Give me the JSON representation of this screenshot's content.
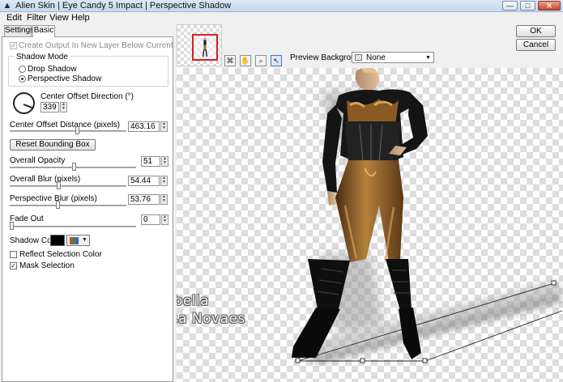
{
  "window": {
    "title": "Alien Skin | Eye Candy 5 Impact | Perspective Shadow",
    "icon": "alien-skin-icon",
    "controls": {
      "minimize": "—",
      "maximize": "□",
      "close": "✕"
    }
  },
  "menu": [
    "Edit",
    "Filter",
    "View",
    "Help"
  ],
  "tabs": [
    {
      "label": "Settings",
      "active": false
    },
    {
      "label": "Basic",
      "active": true
    }
  ],
  "basic": {
    "create_output": {
      "label": "Create Output In New Layer Below Current",
      "checked": true,
      "enabled": false
    },
    "shadow_mode": {
      "title": "Shadow Mode",
      "options": [
        {
          "label": "Drop Shadow",
          "selected": false
        },
        {
          "label": "Perspective Shadow",
          "selected": true
        }
      ]
    },
    "center_offset_direction": {
      "label": "Center Offset Direction (°)",
      "value": "339"
    },
    "center_offset_distance": {
      "label": "Center Offset Distance (pixels)",
      "value": "463.16",
      "level": 0.58
    },
    "reset_button": "Reset Bounding Box",
    "overall_opacity": {
      "label": "Overall Opacity",
      "value": "51",
      "level": 0.51
    },
    "overall_blur": {
      "label": "Overall Blur (pixels)",
      "value": "54.44",
      "level": 0.42
    },
    "perspective_blur": {
      "label": "Perspective Blur (pixels)",
      "value": "53.76",
      "level": 0.41
    },
    "fade_out": {
      "label": "Fade Out",
      "value": "0",
      "level": 0
    },
    "shadow_color": {
      "label": "Shadow Color",
      "value": "#000000"
    },
    "reflect_selection_color": {
      "label": "Reflect Selection Color",
      "checked": false
    },
    "mask_selection": {
      "label": "Mask Selection",
      "checked": true
    }
  },
  "toolbar": {
    "tools": [
      "bounding-box-tool-icon",
      "hand-tool-icon",
      "zoom-tool-icon",
      "pointer-tool-icon"
    ],
    "active_tool": "pointer-tool-icon",
    "preview_background_label": "Preview Background:",
    "preview_background_value": "None"
  },
  "buttons": {
    "ok": "OK",
    "cancel": "Cancel"
  },
  "watermark": {
    "line1": "Tuto by_Suizabella",
    "line2": "Tradução by_Ileusa Novaes"
  }
}
